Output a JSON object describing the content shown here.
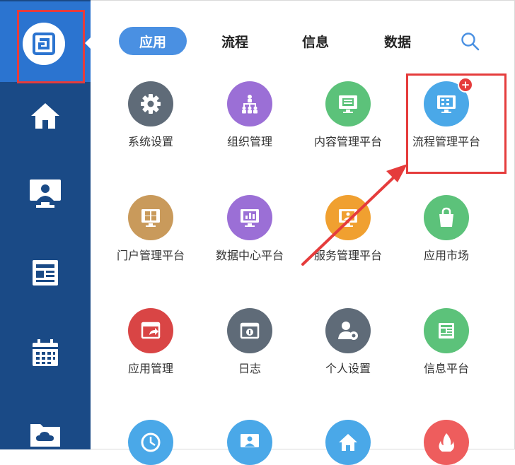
{
  "tabs": [
    {
      "label": "应用",
      "active": true
    },
    {
      "label": "流程",
      "active": false
    },
    {
      "label": "信息",
      "active": false
    },
    {
      "label": "数据",
      "active": false
    }
  ],
  "sidebar": {
    "items": [
      {
        "icon": "home-icon"
      },
      {
        "icon": "monitor-user-icon"
      },
      {
        "icon": "newspaper-icon"
      },
      {
        "icon": "calendar-icon"
      },
      {
        "icon": "folder-cloud-icon"
      }
    ]
  },
  "apps": [
    {
      "label": "系统设置",
      "icon": "gear-icon",
      "color": "#5f6b78"
    },
    {
      "label": "组织管理",
      "icon": "org-chart-icon",
      "color": "#9b6fd6"
    },
    {
      "label": "内容管理平台",
      "icon": "monitor-doc-icon",
      "color": "#5cc27a"
    },
    {
      "label": "流程管理平台",
      "icon": "monitor-flow-icon",
      "color": "#4aa8e8",
      "badge": "+"
    },
    {
      "label": "门户管理平台",
      "icon": "monitor-grid-icon",
      "color": "#c99a5b"
    },
    {
      "label": "数据中心平台",
      "icon": "monitor-chart-icon",
      "color": "#9b6fd6"
    },
    {
      "label": "服务管理平台",
      "icon": "monitor-service-icon",
      "color": "#f0a030"
    },
    {
      "label": "应用市场",
      "icon": "shopping-bag-icon",
      "color": "#5cc27a"
    },
    {
      "label": "应用管理",
      "icon": "window-share-icon",
      "color": "#d94545"
    },
    {
      "label": "日志",
      "icon": "log-icon",
      "color": "#5f6b78"
    },
    {
      "label": "个人设置",
      "icon": "user-gear-icon",
      "color": "#5f6b78"
    },
    {
      "label": "信息平台",
      "icon": "newspaper-icon",
      "color": "#5cc27a"
    },
    {
      "label": "",
      "icon": "clock-icon",
      "color": "#4aa8e8"
    },
    {
      "label": "",
      "icon": "monitor-user-icon",
      "color": "#4aa8e8"
    },
    {
      "label": "",
      "icon": "home-icon",
      "color": "#4aa8e8"
    },
    {
      "label": "",
      "icon": "fire-icon",
      "color": "#ee5d5d"
    }
  ]
}
